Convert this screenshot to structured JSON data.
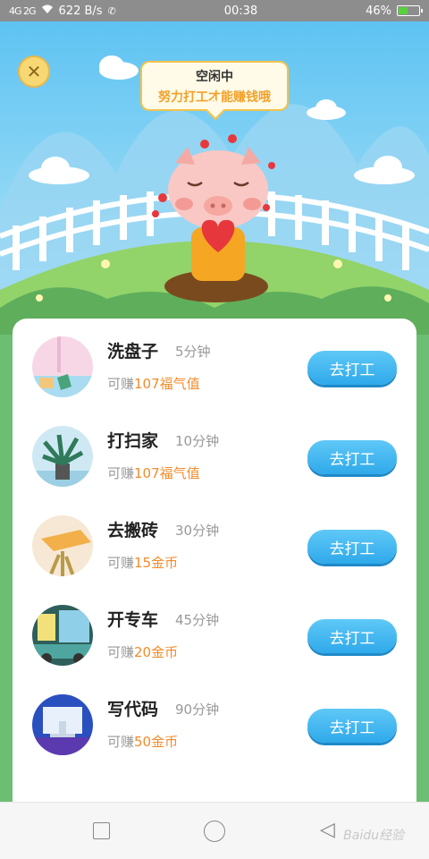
{
  "status_bar": {
    "signal": "4G 2G",
    "speed": "622 B/s",
    "time": "00:38",
    "battery": "46%",
    "battery_level": 0.46,
    "colors": {
      "bar": "#8d8d8d",
      "battery_fill": "#58d23b"
    }
  },
  "scene": {
    "bubble_title": "空闲中",
    "bubble_subtitle": "努力打工才能赚钱哦"
  },
  "tasks": [
    {
      "title": "洗盘子",
      "duration": "5分钟",
      "reward_prefix": "可赚",
      "reward_amount": "107福气值",
      "button": "去打工",
      "icon": "dish-washing-thumbnail"
    },
    {
      "title": "打扫家",
      "duration": "10分钟",
      "reward_prefix": "可赚",
      "reward_amount": "107福气值",
      "button": "去打工",
      "icon": "houseplant-thumbnail"
    },
    {
      "title": "去搬砖",
      "duration": "30分钟",
      "reward_prefix": "可赚",
      "reward_amount": "15金币",
      "button": "去打工",
      "icon": "bricks-thumbnail"
    },
    {
      "title": "开专车",
      "duration": "45分钟",
      "reward_prefix": "可赚",
      "reward_amount": "20金币",
      "button": "去打工",
      "icon": "car-thumbnail"
    },
    {
      "title": "写代码",
      "duration": "90分钟",
      "reward_prefix": "可赚",
      "reward_amount": "50金币",
      "button": "去打工",
      "icon": "computer-thumbnail"
    }
  ],
  "colors": {
    "accent": "#2fa9ea",
    "reward": "#f18b2a",
    "bubble_border": "#f2c24c",
    "sky": "#5ec3f2",
    "grass": "#6cbf72"
  },
  "nav": {
    "watermark": "Baidu经验"
  }
}
